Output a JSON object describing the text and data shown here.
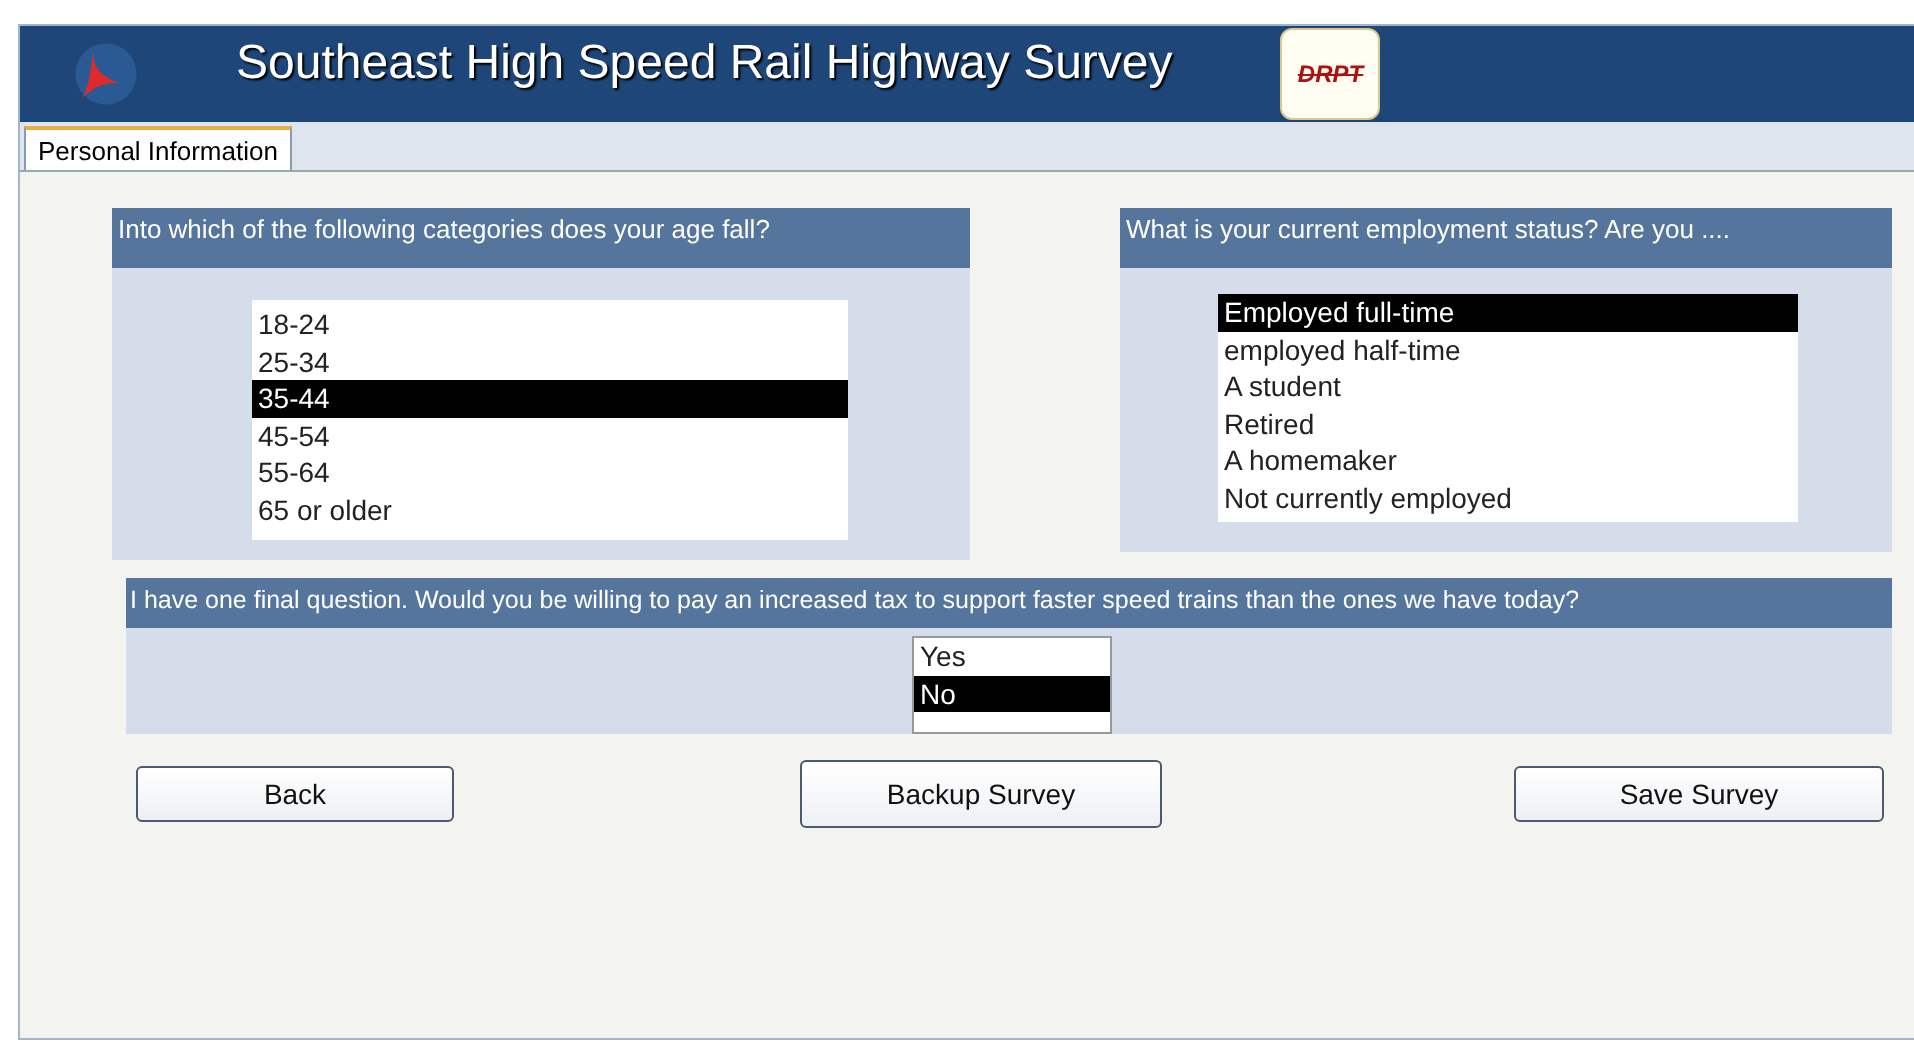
{
  "header": {
    "title": "Southeast High Speed Rail Highway Survey",
    "logo_text": "DRPT"
  },
  "tabs": [
    {
      "label": "Personal Information",
      "selected": true
    }
  ],
  "questions": [
    {
      "prompt": "Into which of the following categories does your age fall?",
      "options": [
        {
          "label": "18-24",
          "selected": false
        },
        {
          "label": "25-34",
          "selected": false
        },
        {
          "label": "35-44",
          "selected": true
        },
        {
          "label": "45-54",
          "selected": false
        },
        {
          "label": "55-64",
          "selected": false
        },
        {
          "label": "65 or older",
          "selected": false
        }
      ]
    },
    {
      "prompt": "What is your current employment status? Are you ....",
      "options": [
        {
          "label": "Employed full-time",
          "selected": true
        },
        {
          "label": "employed half-time",
          "selected": false
        },
        {
          "label": "A student",
          "selected": false
        },
        {
          "label": "Retired",
          "selected": false
        },
        {
          "label": "A homemaker",
          "selected": false
        },
        {
          "label": "Not currently employed",
          "selected": false
        }
      ]
    },
    {
      "prompt": "I have one final question. Would you be willing to pay an increased tax to support faster speed trains than the ones we have today?",
      "options": [
        {
          "label": "Yes",
          "selected": false
        },
        {
          "label": "No",
          "selected": true
        }
      ]
    }
  ],
  "buttons": [
    "Back",
    "Backup Survey",
    "Save Survey"
  ]
}
